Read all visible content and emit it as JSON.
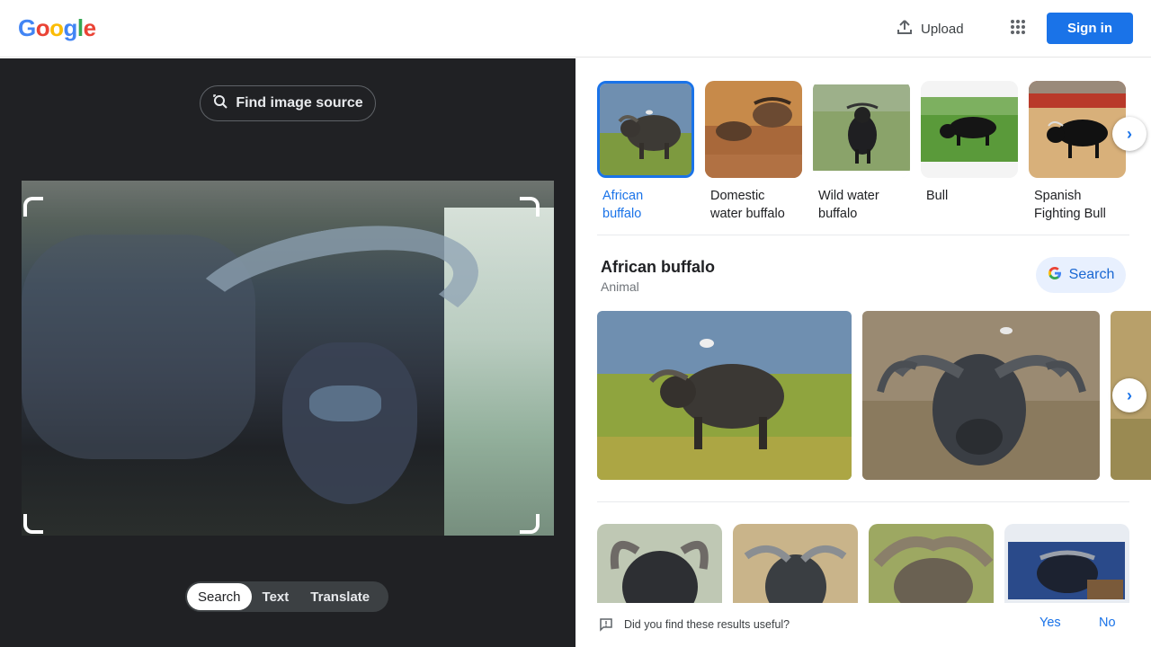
{
  "header": {
    "logo_letters": [
      "G",
      "o",
      "o",
      "g",
      "l",
      "e"
    ],
    "logo_colors": [
      "#4285f4",
      "#ea4335",
      "#fbbc05",
      "#4285f4",
      "#34a853",
      "#ea4335"
    ],
    "upload_label": "Upload",
    "signin_label": "Sign in"
  },
  "left_panel": {
    "find_source_label": "Find image source",
    "modes": [
      "Search",
      "Text",
      "Translate"
    ],
    "active_mode": "Search"
  },
  "related_chips": [
    {
      "label_line1": "African",
      "label_line2": "buffalo",
      "selected": true
    },
    {
      "label_line1": "Domestic",
      "label_line2": "water buffalo",
      "selected": false
    },
    {
      "label_line1": "Wild water",
      "label_line2": "buffalo",
      "selected": false
    },
    {
      "label_line1": "Bull",
      "label_line2": "",
      "selected": false
    },
    {
      "label_line1": "Spanish",
      "label_line2": "Fighting Bull",
      "selected": false
    }
  ],
  "knowledge_panel": {
    "title": "African buffalo",
    "subtitle": "Animal",
    "search_label": "Search"
  },
  "feedback": {
    "question": "Did you find these results useful?",
    "yes_label": "Yes",
    "no_label": "No"
  },
  "colors": {
    "accent": "#1a73e8",
    "dark_panel": "#202124"
  }
}
